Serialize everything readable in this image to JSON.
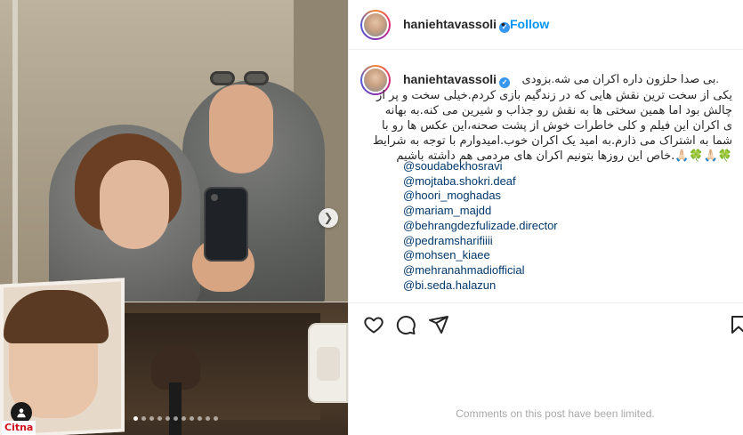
{
  "brand": {
    "logo_text": "Citna",
    "logo_color": "#d0121b"
  },
  "post": {
    "username": "haniehtavassoli",
    "separator": "•",
    "follow_label": "Follow",
    "follow_color": "#0095f6",
    "carousel": {
      "slide_count": 11,
      "active_index": 0
    }
  },
  "caption": {
    "username": "haniehtavassoli",
    "first_line": ".بی صدا حلزون داره اکران می شه.بزودی",
    "lines": [
      "یکی از سخت ترین نقش هایی که در زندگیم بازی کردم.خیلی سخت و پر از",
      "چالش بود اما همین سختی ها به نقش رو جذاب و شیرین می کنه.به بهانه",
      "ی اکران این فیلم و کلی خاطرات خوش از پشت صحنه،این عکس ها رو با",
      "شما به اشتراک می ذارم.به امید یک اکران خوب.امیدوارم با توجه به شرایط",
      "🍀🙏🏻🍀🙏🏻.خاص این روزها بتونیم اکران های مردمی هم داشته باشیم"
    ],
    "mentions": [
      "@soudabekhosravi",
      "@mojtaba.shokri.deaf",
      "@hoori_moghadas",
      "@mariam_majdd",
      "@behrangdezfulizade.director",
      "@pedramsharifiiii",
      "@mohsen_kiaee",
      "@mehranahmadiofficial",
      "@bi.seda.halazun"
    ],
    "mention_color": "#00376b"
  },
  "footer": {
    "comments_limited": "Comments on this post have been limited."
  },
  "icons": [
    "heart-icon",
    "comment-icon",
    "share-icon",
    "bookmark-icon",
    "verified-badge-icon",
    "chevron-right-icon",
    "tag-person-icon"
  ]
}
